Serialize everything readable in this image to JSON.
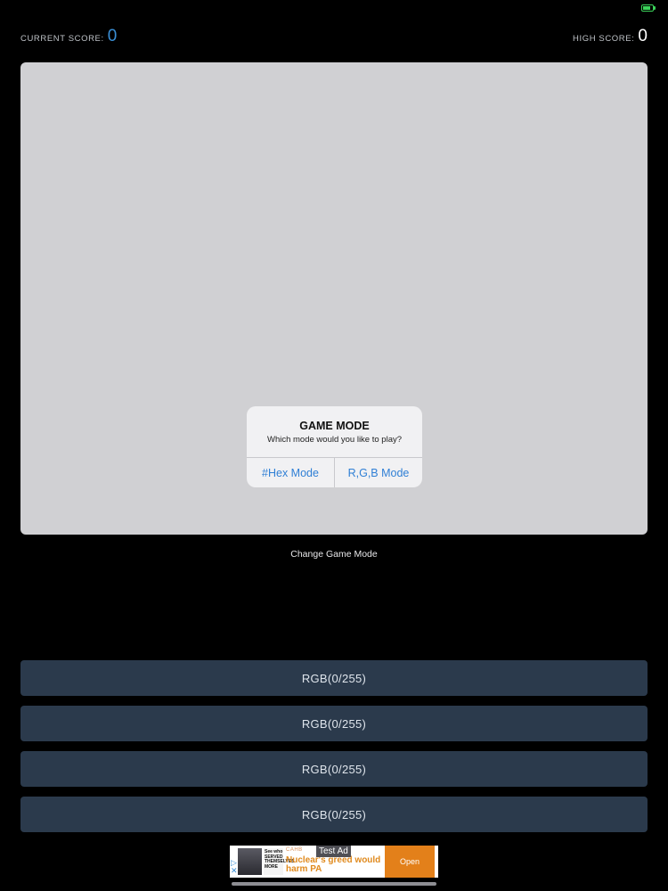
{
  "score": {
    "current_label": "CURRENT SCORE:",
    "current_value": "0",
    "high_label": "HIGH SCORE:",
    "high_value": "0"
  },
  "color_panel": {
    "color": "#d0d0d3"
  },
  "dialog": {
    "title": "GAME MODE",
    "message": "Which mode would you like to play?",
    "actions": [
      "#Hex Mode",
      "R,G,B Mode"
    ]
  },
  "change_mode_label": "Change Game Mode",
  "answers": [
    "RGB(0/255)",
    "RGB(0/255)",
    "RGB(0/255)",
    "RGB(0/255)"
  ],
  "ad": {
    "label": "Test Ad",
    "brand": "CAHB",
    "thumb_text": "See who SERVED THEMSELVES MORE",
    "headline": "Nuclear's greed would harm PA",
    "cta": "Open"
  },
  "colors": {
    "background": "#000000",
    "answer_button": "#2b3a4c",
    "accent_blue": "#3a8fd6",
    "ad_cta": "#e3801a",
    "battery": "#3bd35a"
  }
}
